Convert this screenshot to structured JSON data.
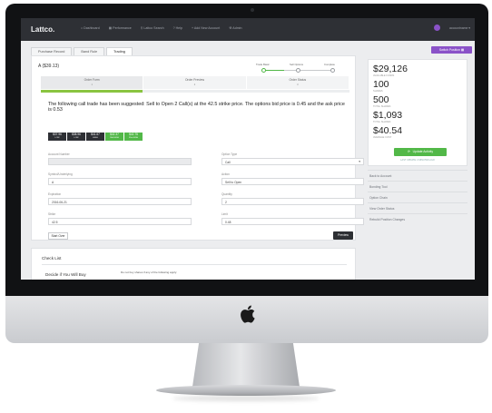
{
  "app": {
    "logo": "Lattco."
  },
  "nav": {
    "items": [
      {
        "label": "Dashboard",
        "icon": "home-icon"
      },
      {
        "label": "Performance",
        "icon": "chart-icon"
      },
      {
        "label": "Lattco Search",
        "icon": "search-icon"
      },
      {
        "label": "Help",
        "icon": "help-icon"
      },
      {
        "label": "Add New Account",
        "icon": "plus-icon"
      },
      {
        "label": "Admin",
        "icon": "wrench-icon"
      }
    ],
    "user_menu": "accountname ▾"
  },
  "tabs": [
    {
      "label": "Purchase Record",
      "active": false
    },
    {
      "label": "Band Rule",
      "active": false
    },
    {
      "label": "Trading",
      "active": true
    }
  ],
  "switch_button": "Switch Position",
  "trade": {
    "title": "A ($39.13)",
    "stepper": [
      {
        "label": "Trade Basic",
        "done": true
      },
      {
        "label": "Sell Options",
        "done": false
      },
      {
        "label": "Complete",
        "done": false
      }
    ],
    "stepper_progress": 0.3,
    "sub_tabs": [
      {
        "label": "Order Form",
        "num": "1"
      },
      {
        "label": "Order Preview",
        "num": "2"
      },
      {
        "label": "Order Status",
        "num": "3"
      }
    ],
    "progress": 0.33,
    "suggestion": "The following call trade has been suggested: Sell to Open 2 Call(s) at the 42.5 strike price. The options bid price is 0.45 and the ask price is 0.53",
    "chips": [
      {
        "value": "$37.96",
        "label": "LOW",
        "color": "#2e3035"
      },
      {
        "value": "$38.96",
        "label": "LOW",
        "color": "#2e3035"
      },
      {
        "value": "$41.67",
        "label": "HIGH",
        "color": "#2e3035"
      },
      {
        "value": "$42.37",
        "label": "30d HIGH",
        "color": "#52b848"
      },
      {
        "value": "$42.75",
        "label": "52w HIGH",
        "color": "#52b848"
      }
    ]
  },
  "form": {
    "account_number": {
      "label": "Account Number",
      "value": ""
    },
    "option_type": {
      "label": "Option Type",
      "value": "Call"
    },
    "symbol": {
      "label": "Symbol/Underlying",
      "value": "A"
    },
    "action": {
      "label": "Action",
      "value": "Sell to Open"
    },
    "expiration": {
      "label": "Expiration",
      "value": "2016-06-21"
    },
    "quantity": {
      "label": "Quantity",
      "value": "2"
    },
    "strike": {
      "label": "Strike",
      "value": "42.5"
    },
    "limit": {
      "label": "Limit",
      "value": "0.48"
    }
  },
  "buttons": {
    "start_over": "Start Over",
    "preview": "Preview"
  },
  "checklist": {
    "title": "Check List",
    "question": "Decide if You Will Buy",
    "note": "Do not buy shares if any of the following apply:"
  },
  "stats": [
    {
      "value": "$29,126",
      "label": "AVAILABLE FUNDS"
    },
    {
      "value": "100",
      "label": "SHARES"
    },
    {
      "value": "500",
      "label": "TOTAL SHARES"
    },
    {
      "value": "$1,093",
      "label": "TOTAL SHARES"
    },
    {
      "value": "$40.54",
      "label": "AVERAGE COST"
    }
  ],
  "update_button": "Update Activity",
  "last_update": "LAST UPDATE: 2 MINUTES AGO",
  "side_links": [
    "Back to Account",
    "Bonding Tool",
    "Option Chain",
    "View Order Status",
    "Rebuild Position Changes"
  ],
  "colors": {
    "accent_purple": "#8a52c8",
    "accent_green": "#52b848",
    "nav_dark": "#2e3035"
  }
}
